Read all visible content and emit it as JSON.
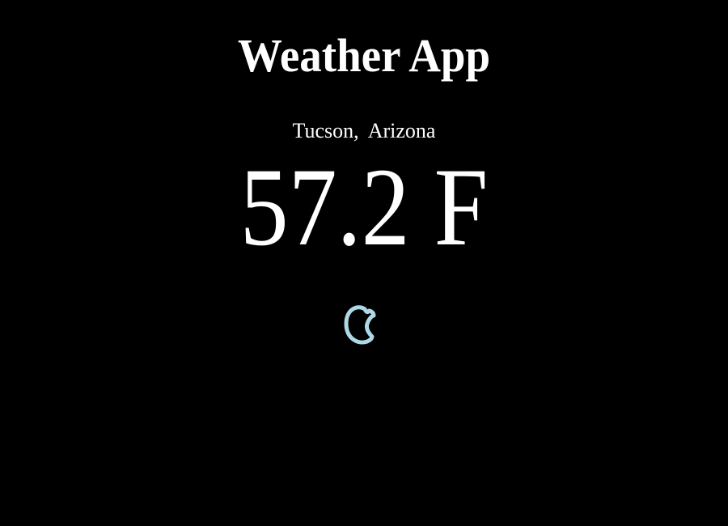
{
  "app": {
    "title": "Weather App",
    "location": "Tucson,  Arizona",
    "temperature": "57.2 F",
    "condition_icon": "moon-icon",
    "colors": {
      "background": "#000000",
      "text": "#ffffff",
      "icon": "#add8e6"
    }
  }
}
